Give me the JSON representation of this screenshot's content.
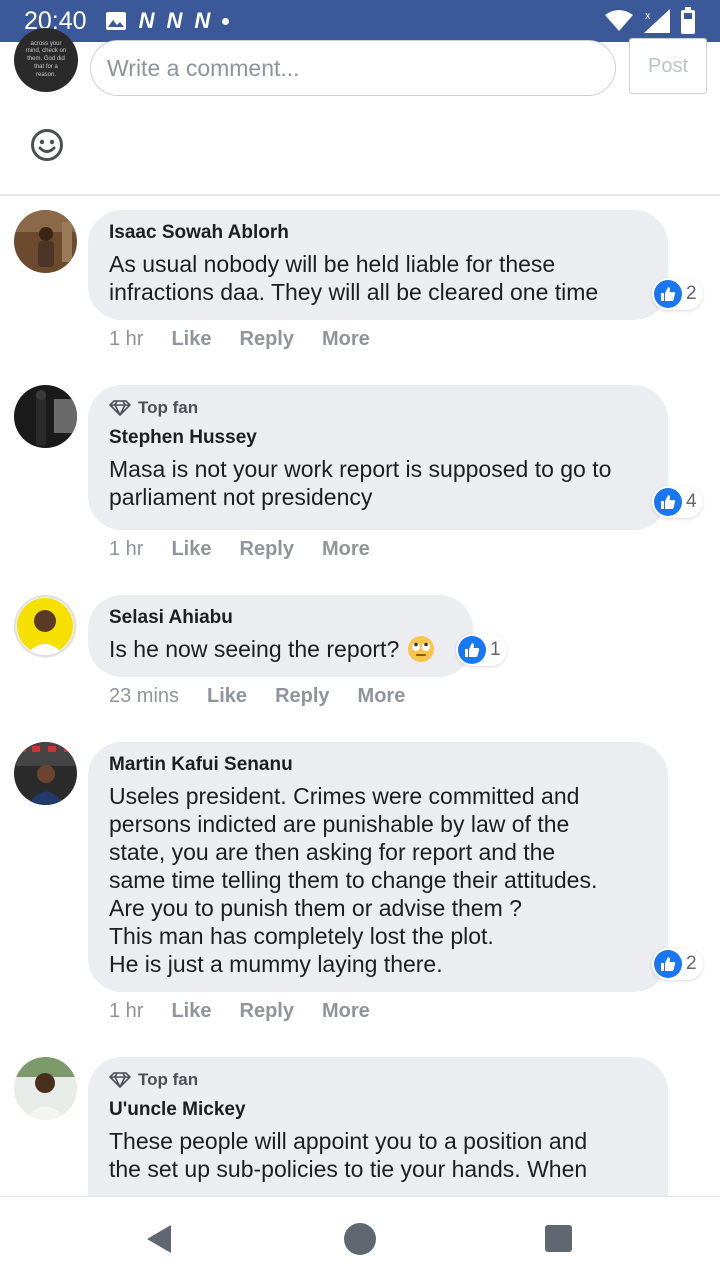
{
  "status_bar": {
    "time": "20:40",
    "icons": [
      "image-icon",
      "n-notification-icon",
      "n-notification-icon",
      "n-notification-icon",
      "dot-icon"
    ],
    "notif_glyph": "N",
    "right_icons": [
      "wifi-icon",
      "signal-icon",
      "battery-icon"
    ],
    "bg_color": "#3b5998"
  },
  "composer": {
    "avatar_text": "across your mind, check on them. God did that for a reason.",
    "placeholder": "Write a comment...",
    "post_label": "Post",
    "emoji_icon": "smiley-icon"
  },
  "labels": {
    "top_fan": "Top fan",
    "like": "Like",
    "reply": "Reply",
    "more": "More"
  },
  "comments": [
    {
      "author": "Isaac Sowah Ablorh",
      "text": "As usual nobody will be held liable for these\ninfractions daa. They will all be cleared one time",
      "time": "1 hr",
      "likes": "2",
      "top_fan": false
    },
    {
      "author": "Stephen Hussey",
      "text": "Masa is not your work report is supposed to go to\nparliament not presidency",
      "time": "1 hr",
      "likes": "4",
      "top_fan": true
    },
    {
      "author": "Selasi Ahiabu",
      "text": "Is he now seeing the report?",
      "emoji": "eye-roll-emoji-icon",
      "time": "23 mins",
      "likes": "1",
      "top_fan": false
    },
    {
      "author": "Martin Kafui Senanu",
      "text": "Useles president. Crimes were committed and\npersons indicted are punishable by law of the\nstate, you are then asking for report and the\nsame time telling them to change their attitudes.\nAre you to punish them or advise them ?\nThis man has completely lost the plot.\nHe is just a mummy laying there.",
      "time": "1 hr",
      "likes": "2",
      "top_fan": false
    },
    {
      "author": "U'uncle Mickey",
      "text": "These people will appoint you to a position and\nthe set up sub-policies to tie your hands. When",
      "top_fan": true
    }
  ],
  "nav_bar": {
    "icons": [
      "back-icon",
      "home-icon",
      "recents-icon"
    ]
  },
  "colors": {
    "like_blue": "#1877f2",
    "bubble": "#ebedf0",
    "meta_gray": "#90949c"
  }
}
